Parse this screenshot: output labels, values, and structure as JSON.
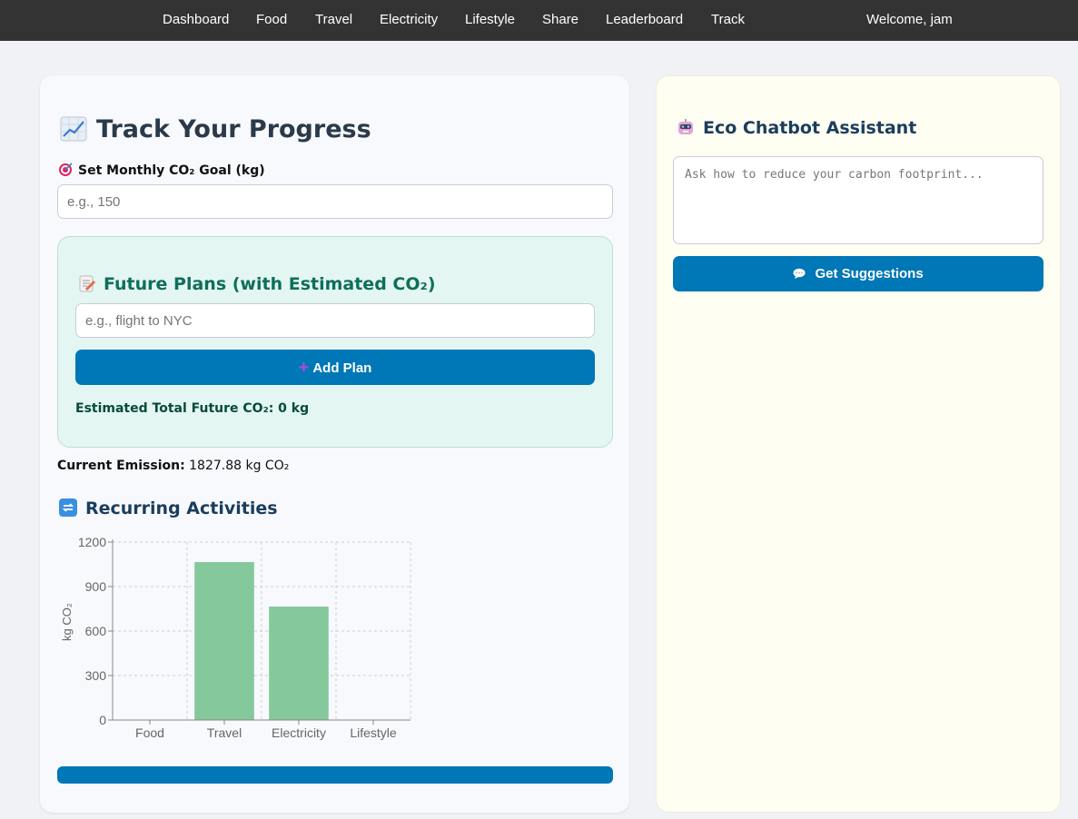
{
  "nav": {
    "items": [
      "Dashboard",
      "Food",
      "Travel",
      "Electricity",
      "Lifestyle",
      "Share",
      "Leaderboard",
      "Track"
    ],
    "welcome": "Welcome, jam"
  },
  "track": {
    "title": "Track Your Progress",
    "title_icon": "chart-increasing-icon",
    "goal_label": "Set Monthly CO₂ Goal (kg)",
    "goal_icon": "target-icon",
    "goal_placeholder": "e.g., 150",
    "goal_value": ""
  },
  "plans": {
    "title": "Future Plans (with Estimated CO₂)",
    "title_icon": "memo-icon",
    "placeholder": "e.g., flight to NYC",
    "add_label": "Add Plan",
    "add_icon": "plus-icon",
    "estimate_text": "Estimated Total Future CO₂: 0 kg"
  },
  "current": {
    "label": "Current Emission:",
    "value": "1827.88 kg CO₂"
  },
  "recurring": {
    "title": "Recurring Activities",
    "title_icon": "repeat-icon"
  },
  "chart_data": {
    "type": "bar",
    "categories": [
      "Food",
      "Travel",
      "Electricity",
      "Lifestyle"
    ],
    "values": [
      0,
      1065,
      765,
      0
    ],
    "ylabel": "kg CO₂",
    "xlabel": "",
    "ylim": [
      0,
      1200
    ],
    "yticks": [
      0,
      300,
      600,
      900,
      1200
    ],
    "grid": true,
    "bar_color": "#84c89b"
  },
  "chatbot": {
    "title": "Eco Chatbot Assistant",
    "title_icon": "robot-icon",
    "placeholder": "Ask how to reduce your carbon footprint...",
    "button_label": "Get Suggestions",
    "button_icon": "speech-bubble-icon"
  },
  "colors": {
    "nav_bg": "#333333",
    "accent": "#0077b6",
    "plans_bg": "#e4f6f1",
    "chatbot_bg": "#fefef3",
    "heading_teal": "#0f6e5c",
    "heading_navy": "#1b3d5c"
  }
}
